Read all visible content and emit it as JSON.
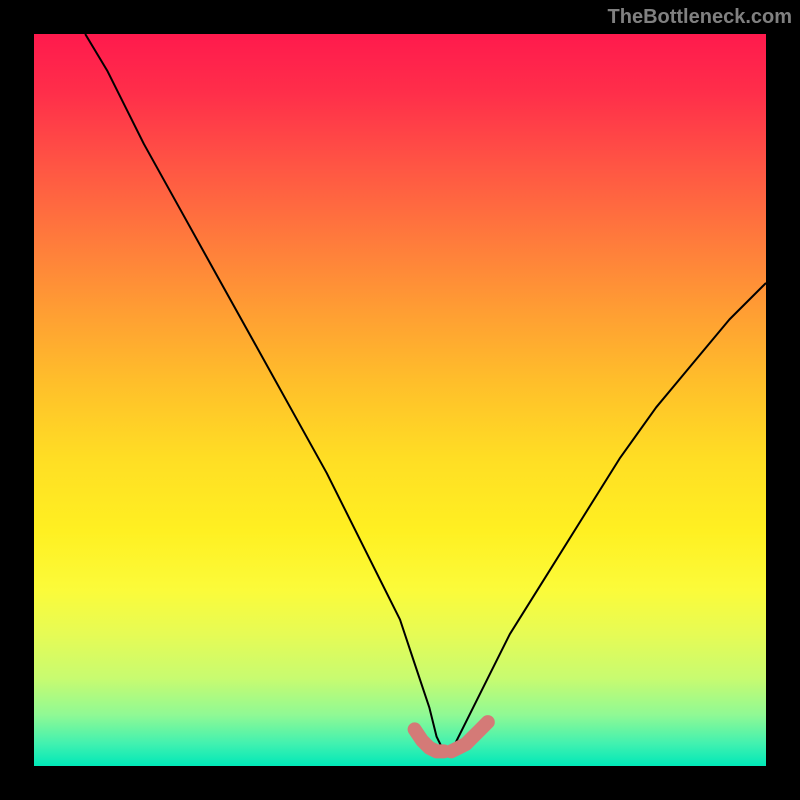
{
  "attribution": "TheBottleneck.com",
  "chart_data": {
    "type": "line",
    "title": "",
    "xlabel": "",
    "ylabel": "",
    "xlim": [
      0,
      100
    ],
    "ylim": [
      0,
      100
    ],
    "series": [
      {
        "name": "bottleneck-curve",
        "x": [
          7,
          10,
          15,
          20,
          25,
          30,
          35,
          40,
          45,
          50,
          52,
          54,
          55,
          56,
          57,
          58,
          60,
          62,
          65,
          70,
          75,
          80,
          85,
          90,
          95,
          100
        ],
        "values": [
          100,
          95,
          85,
          76,
          67,
          58,
          49,
          40,
          30,
          20,
          14,
          8,
          4,
          2,
          2,
          4,
          8,
          12,
          18,
          26,
          34,
          42,
          49,
          55,
          61,
          66
        ]
      }
    ],
    "markers": {
      "name": "highlight-region",
      "color": "#d47a77",
      "points_x": [
        52,
        53,
        54,
        55,
        56,
        57,
        58,
        59,
        60,
        61,
        62
      ],
      "points_y": [
        5,
        3.5,
        2.5,
        2,
        2,
        2,
        2.5,
        3,
        4,
        5,
        6
      ]
    },
    "gradient_stops": [
      {
        "pos": 0,
        "color": "#ff1a4d"
      },
      {
        "pos": 8,
        "color": "#ff2e4a"
      },
      {
        "pos": 18,
        "color": "#ff5544"
      },
      {
        "pos": 28,
        "color": "#ff7a3c"
      },
      {
        "pos": 38,
        "color": "#ff9e33"
      },
      {
        "pos": 48,
        "color": "#ffc02a"
      },
      {
        "pos": 58,
        "color": "#ffde24"
      },
      {
        "pos": 68,
        "color": "#fff022"
      },
      {
        "pos": 76,
        "color": "#fbfb3a"
      },
      {
        "pos": 82,
        "color": "#e6fb55"
      },
      {
        "pos": 88,
        "color": "#c8fb70"
      },
      {
        "pos": 93,
        "color": "#90f994"
      },
      {
        "pos": 97,
        "color": "#40f1b0"
      },
      {
        "pos": 100,
        "color": "#00e8b8"
      }
    ]
  }
}
